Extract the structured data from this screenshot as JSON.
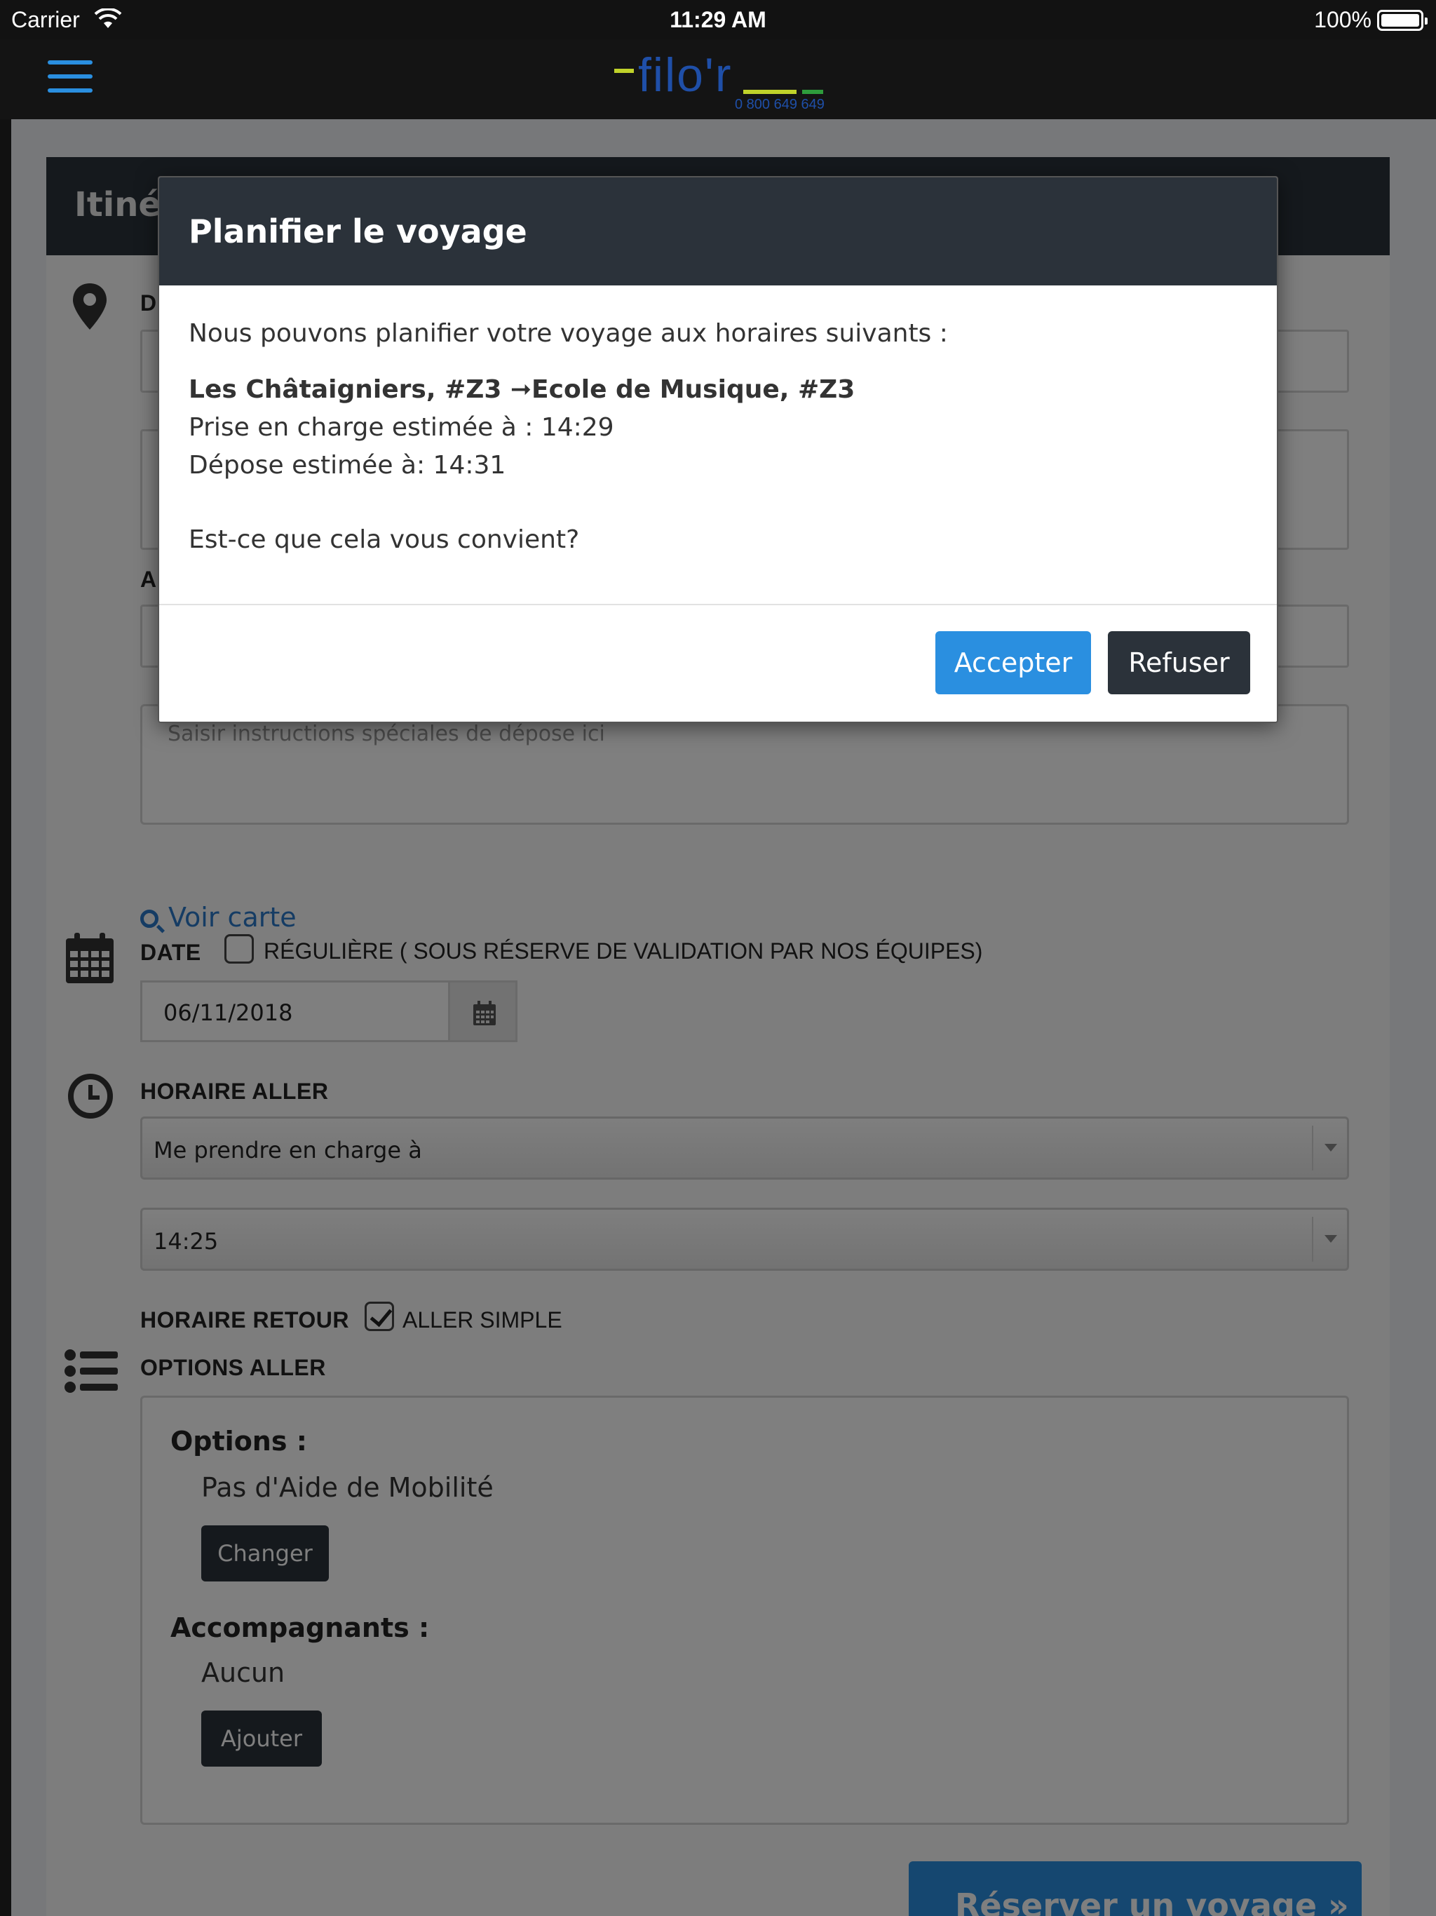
{
  "status_bar": {
    "carrier": "Carrier",
    "time": "11:29 AM",
    "battery": "100%"
  },
  "header": {
    "logo_text": "filo'r",
    "logo_phone": "0 800 649 649"
  },
  "form": {
    "panel_title": "Itinéraire",
    "depart_label": "D",
    "arrivee_label": "A",
    "dropoff_instructions_placeholder": "Saisir instructions spéciales de dépose ici",
    "voir_carte": "Voir carte",
    "date_label": "DATE",
    "reguliere_label": "RÉGULIÈRE ( SOUS RÉSERVE DE VALIDATION PAR NOS ÉQUIPES)",
    "date_value": "06/11/2018",
    "horaire_aller_label": "HORAIRE ALLER",
    "pickup_mode": "Me prendre en charge à",
    "pickup_time": "14:25",
    "horaire_retour_label": "HORAIRE RETOUR",
    "aller_simple_label": "ALLER SIMPLE",
    "aller_simple_checked": true,
    "options_aller_label": "OPTIONS ALLER",
    "options_title": "Options :",
    "options_value": "Pas d'Aide de Mobilité",
    "change_button": "Changer",
    "companions_title": "Accompagnants :",
    "companions_value": "Aucun",
    "add_button": "Ajouter",
    "reserve_button": "Réserver un voyage »"
  },
  "modal": {
    "title": "Planifier le voyage",
    "intro": "Nous pouvons planifier votre voyage aux horaires suivants :",
    "route": "Les Châtaigniers, #Z3 ➞Ecole de Musique, #Z3",
    "pickup": "Prise en charge estimée à : 14:29",
    "dropoff": "Dépose estimée à: 14:31",
    "question": "Est-ce que cela vous convient?",
    "accept_button": "Accepter",
    "refuse_button": "Refuser"
  },
  "colors": {
    "accent": "#2a8fe0",
    "dark": "#2b323a",
    "logo_blue": "#1f4fa8",
    "logo_lime": "#c0d22a",
    "logo_green": "#2e9c3c"
  }
}
